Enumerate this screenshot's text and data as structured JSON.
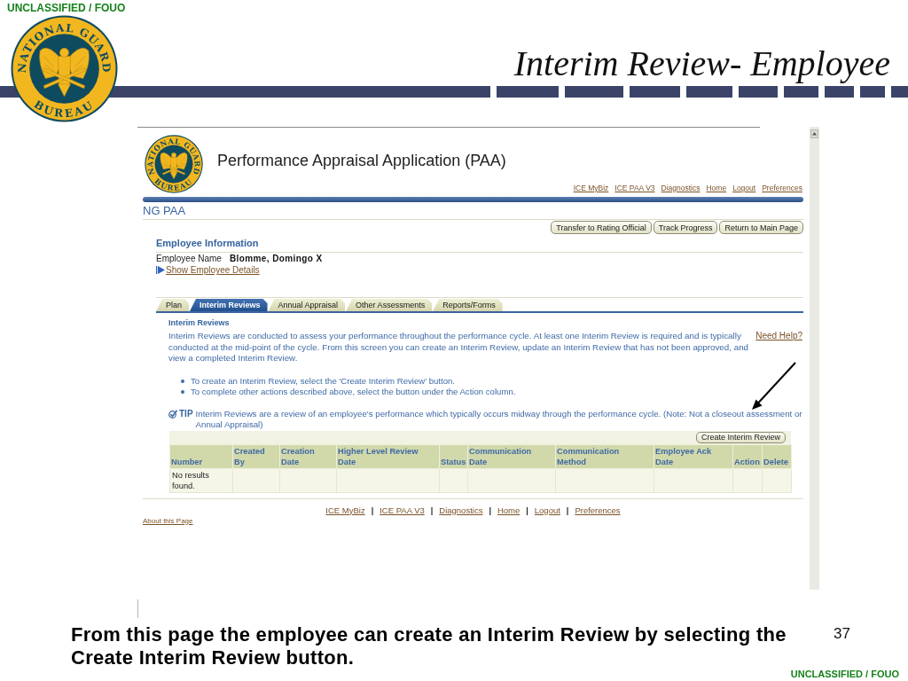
{
  "top_classification": "UNCLASSIFIED / FOUO",
  "seal": {
    "top_text": "NATIONAL GUARD",
    "bottom_text": "BUREAU"
  },
  "slide_title": "Interim Review- Employee",
  "screenshot": {
    "app_seal": {
      "top_text": "NATIONAL GUARD",
      "bottom_text": "BUREAU"
    },
    "app_title": "Performance Appraisal Application (PAA)",
    "global_links": [
      "ICE MyBiz",
      "ICE PAA V3",
      "Diagnostics",
      "Home",
      "Logout",
      "Preferences"
    ],
    "section_title": "NG PAA",
    "page_buttons": [
      "Transfer to Rating Official",
      "Track Progress",
      "Return to Main Page"
    ],
    "employee": {
      "heading": "Employee Information",
      "fields": [
        {
          "label": "Employee Name",
          "value": "Blomme, Domingo X"
        }
      ],
      "details_link": {
        "label": "Show Employee Details",
        "expanded": false
      }
    },
    "tabs": [
      {
        "label": "Plan",
        "selected": false
      },
      {
        "label": "Interim Reviews",
        "selected": true
      },
      {
        "label": "Annual Appraisal",
        "selected": false
      },
      {
        "label": "Other Assessments",
        "selected": false
      },
      {
        "label": "Reports/Forms",
        "selected": false
      }
    ],
    "panel": {
      "heading": "Interim Reviews",
      "intro": "Interim Reviews are conducted to assess your performance throughout the performance cycle. At least one Interim Review is required and is typically conducted at the mid-point of the cycle. From this screen you can create an Interim Review, update an Interim Review that has not been approved, and view a completed Interim Review.",
      "help_link": "Need Help?",
      "bullets": [
        "To create an Interim Review, select the 'Create Interim Review' button.",
        "To complete other actions described above, select the button under the Action column."
      ],
      "tip": {
        "label": "TIP",
        "text": "Interim Reviews are a review of an employee's performance which typically occurs midway through the performance cycle. (Note: Not a closeout assessment or Annual Appraisal)"
      }
    },
    "table": {
      "action_button": "Create Interim Review",
      "columns": [
        "Number",
        "Created By",
        "Creation Date",
        "Higher Level Review Date",
        "Status",
        "Communication Date",
        "Communication Method",
        "Employee Ack Date",
        "Action",
        "Delete"
      ],
      "empty_message": "No results found."
    },
    "footer_items": [
      {
        "kind": "link",
        "text": "ICE MyBiz"
      },
      {
        "kind": "separator",
        "text": "|"
      },
      {
        "kind": "link",
        "text": "ICE PAA V3"
      },
      {
        "kind": "separator",
        "text": "|"
      },
      {
        "kind": "link",
        "text": "Diagnostics"
      },
      {
        "kind": "separator",
        "text": "|"
      },
      {
        "kind": "link",
        "text": "Home"
      },
      {
        "kind": "separator",
        "text": "|"
      },
      {
        "kind": "link",
        "text": "Logout"
      },
      {
        "kind": "separator",
        "text": "|"
      },
      {
        "kind": "link",
        "text": "Preferences"
      }
    ],
    "about_link": "About this Page"
  },
  "caption": "From this page the employee can create an Interim Review by selecting the Create Interim Review button.",
  "page_number": "37",
  "bottom_classification": "UNCLASSIFIED / FOUO"
}
